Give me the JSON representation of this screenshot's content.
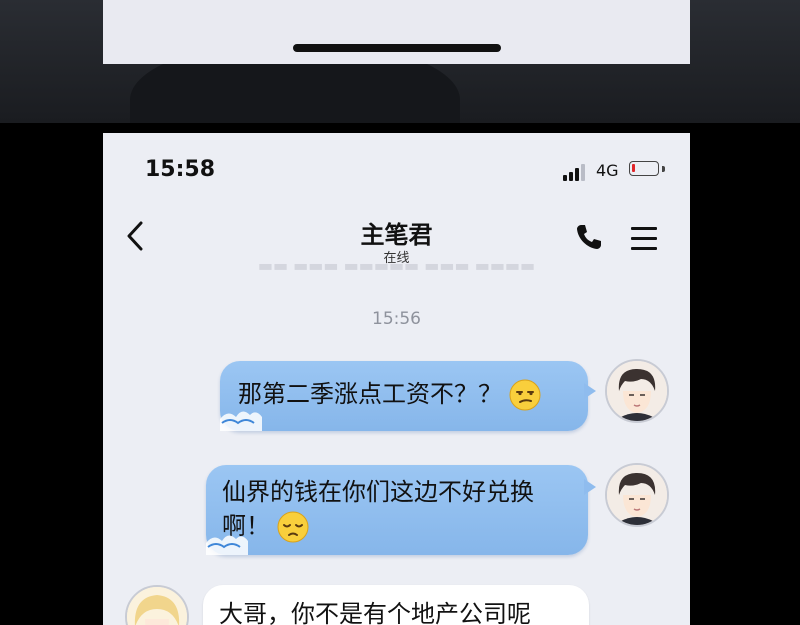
{
  "status_bar": {
    "time": "15:58",
    "network": "4G"
  },
  "chat_header": {
    "contact_name": "主笔君",
    "contact_status": "在线"
  },
  "chat": {
    "timestamp": "15:56",
    "messages": [
      {
        "from": "me",
        "text": "那第二季涨点工资不？？",
        "emoji": "unamused-face-emoji"
      },
      {
        "from": "me",
        "text_line1": "仙界的钱在你们这边不好兑换",
        "text_line2": "啊！",
        "emoji": "pensive-face-emoji"
      },
      {
        "from": "other",
        "text": "大哥，你不是有个地产公司呢"
      }
    ]
  },
  "colors": {
    "sent_bubble": "#8fbcee",
    "received_bubble": "#ffffff",
    "battery_low": "#e0262a",
    "chat_background": "#eceef4"
  }
}
